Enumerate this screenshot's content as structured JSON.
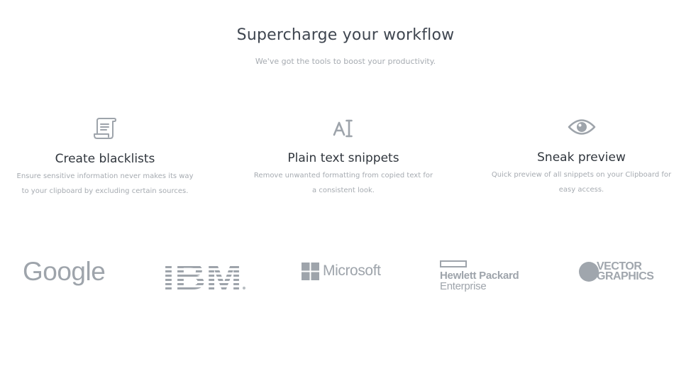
{
  "hero": {
    "title": "Supercharge your workflow",
    "subtitle": "We've got the tools to boost your productivity."
  },
  "features": [
    {
      "icon": "scroll-icon",
      "title": "Create blacklists",
      "description": "Ensure sensitive information never makes its way to your clipboard by excluding certain sources."
    },
    {
      "icon": "text-cursor-icon",
      "title": "Plain text snippets",
      "description": "Remove unwanted formatting from copied text for a consistent look."
    },
    {
      "icon": "eye-icon",
      "title": "Sneak preview",
      "description": "Quick preview of all snippets on your Clipboard for easy access."
    }
  ],
  "logos": {
    "google": "Google",
    "ibm": "IBM",
    "microsoft": "Microsoft",
    "hpe_line1": "Hewlett Packard",
    "hpe_line2": "Enterprise",
    "vector_line1": "VECTOR",
    "vector_line2": "GRAPHICS"
  },
  "colors": {
    "heading": "#3f4650",
    "muted_text": "#a6abb1",
    "icon_gray": "#9ea4ab"
  }
}
